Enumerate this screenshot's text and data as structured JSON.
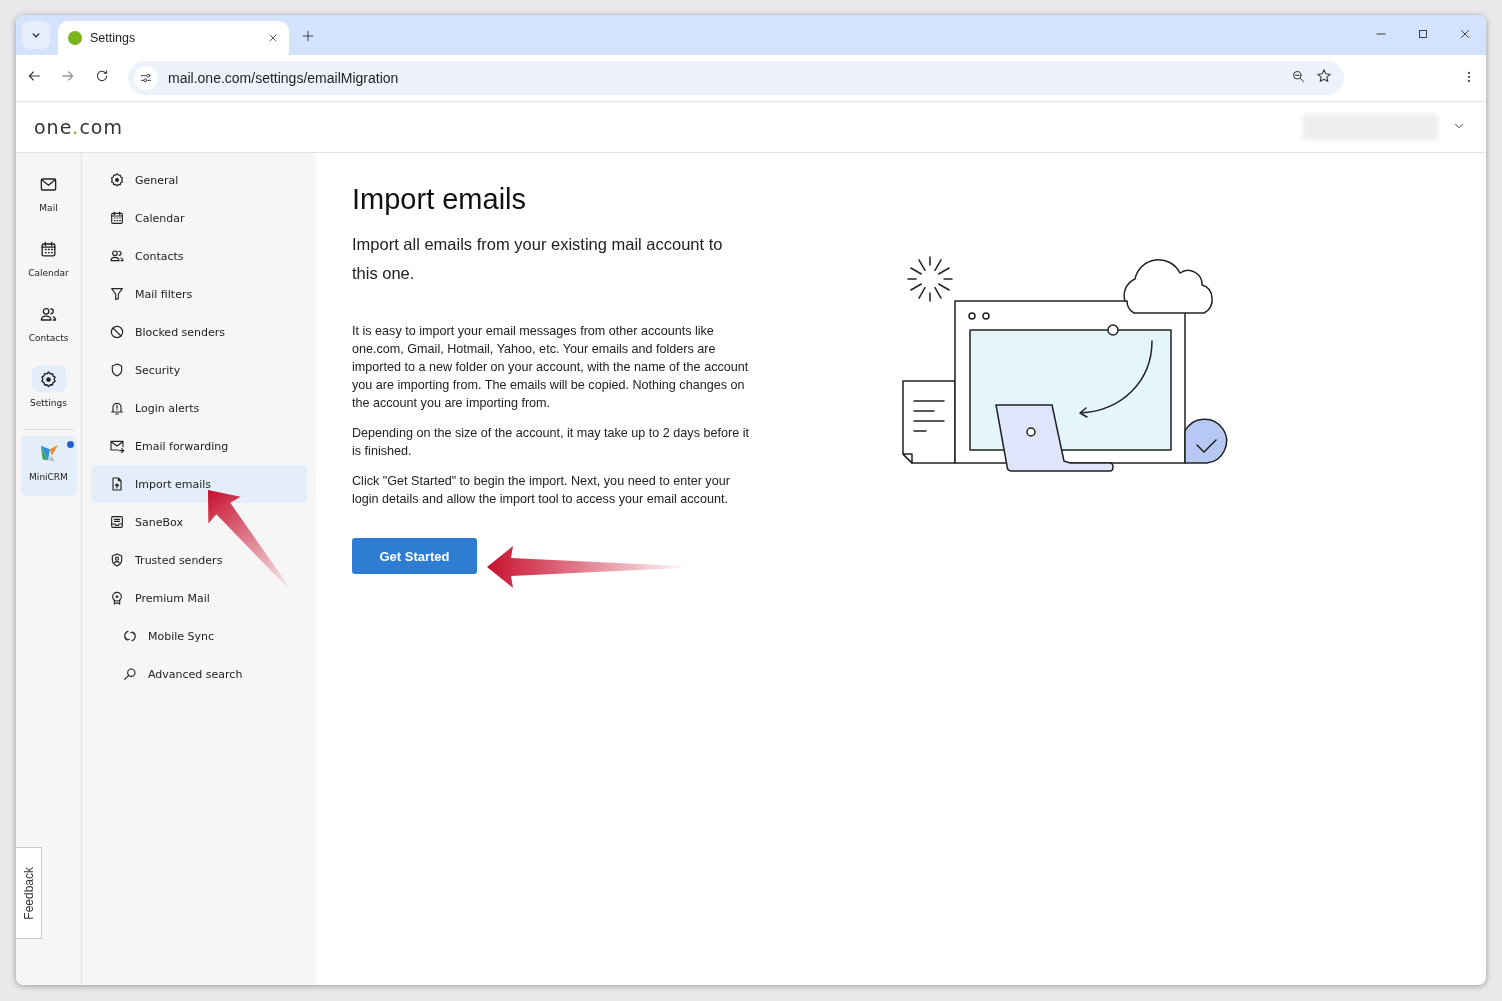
{
  "browser": {
    "tab_title": "Settings",
    "url": "mail.one.com/settings/emailMigration"
  },
  "header": {
    "logo": {
      "name": "one",
      "accent": ".",
      "suffix": "com"
    },
    "account_redacted": true
  },
  "rail": [
    {
      "label": "Mail",
      "selected": false,
      "badge": false
    },
    {
      "label": "Calendar",
      "selected": false,
      "badge": false
    },
    {
      "label": "Contacts",
      "selected": false,
      "badge": false
    },
    {
      "label": "Settings",
      "selected": true,
      "badge": false
    },
    {
      "label": "MiniCRM",
      "selected": false,
      "badge": true,
      "highlighted": true
    }
  ],
  "settings_nav": [
    {
      "label": "General",
      "selected": false
    },
    {
      "label": "Calendar",
      "selected": false
    },
    {
      "label": "Contacts",
      "selected": false
    },
    {
      "label": "Mail filters",
      "selected": false
    },
    {
      "label": "Blocked senders",
      "selected": false
    },
    {
      "label": "Security",
      "selected": false
    },
    {
      "label": "Login alerts",
      "selected": false
    },
    {
      "label": "Email forwarding",
      "selected": false
    },
    {
      "label": "Import emails",
      "selected": true
    },
    {
      "label": "SaneBox",
      "selected": false
    },
    {
      "label": "Trusted senders",
      "selected": false
    },
    {
      "label": "Premium Mail",
      "selected": false,
      "children": [
        {
          "label": "Mobile Sync",
          "selected": false
        },
        {
          "label": "Advanced search",
          "selected": false
        }
      ]
    }
  ],
  "content": {
    "title": "Import emails",
    "subtitle": "Import all emails from your existing mail account to this one.",
    "paragraphs": [
      "It is easy to import your email messages from other accounts like one.com, Gmail, Hotmail, Yahoo, etc. Your emails and folders are imported to a new folder on your account, with the name of the account you are importing from. The emails will be copied. Nothing changes on the account you are importing from.",
      "Depending on the size of the account, it may take up to 2 days before it is finished.",
      "Click \"Get Started\" to begin the import. Next, you need to enter your login details and allow the import tool to access your email account."
    ],
    "button": "Get Started"
  },
  "feedback": "Feedback"
}
